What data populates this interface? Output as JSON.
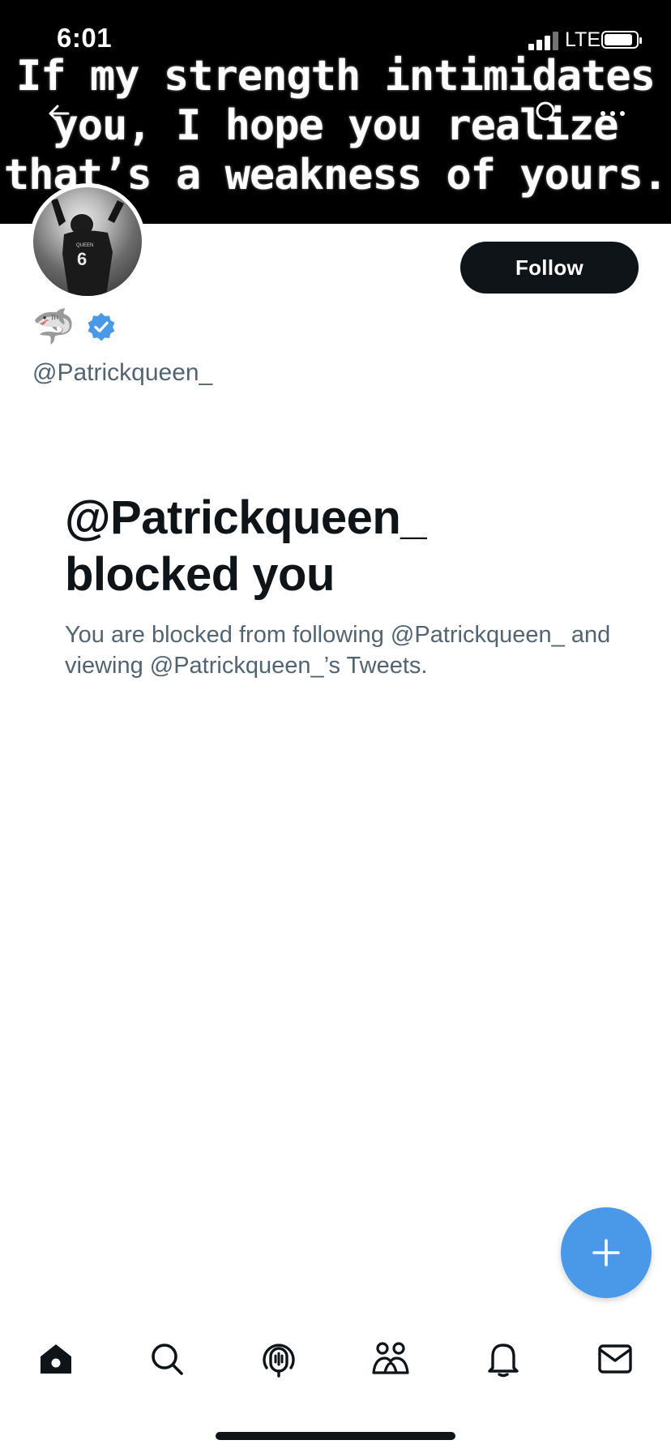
{
  "status_bar": {
    "time": "6:01",
    "network": "LTE"
  },
  "banner": {
    "lines": [
      "If my strength intimidates",
      "you, I hope you realize",
      "that’s a weakness of yours."
    ]
  },
  "profile": {
    "name_emoji": "🦈",
    "handle": "@Patrickqueen_",
    "follow_label": "Follow",
    "verified": true,
    "jersey_text": "QUEEN",
    "jersey_number": "6"
  },
  "blocked": {
    "title_line1": "@Patrickqueen_",
    "title_line2": "blocked you",
    "description": "You are blocked from following @Patrickqueen_ and viewing @Patrickqueen_’s Tweets."
  },
  "icons": {
    "back": "back-arrow-icon",
    "search": "search-icon",
    "more": "more-icon",
    "fab": "plus-icon",
    "tabs": [
      "home-icon",
      "search-icon",
      "spaces-icon",
      "communities-icon",
      "notifications-icon",
      "messages-icon"
    ]
  },
  "colors": {
    "accent": "#4a99e9",
    "verified": "#4a99e9",
    "text_primary": "#0f1419",
    "text_secondary": "#536471",
    "banner_bg": "#000000"
  }
}
